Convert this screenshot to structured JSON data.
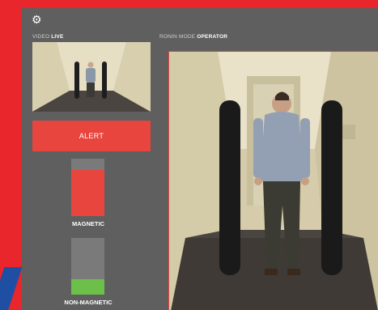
{
  "toolbar": {
    "settings_icon": "gear-icon"
  },
  "video": {
    "label": "VIDEO",
    "status": "LIVE"
  },
  "ronin": {
    "label": "RONIN MODE",
    "mode": "OPERATOR"
  },
  "alert": {
    "label": "ALERT"
  },
  "meters": {
    "magnetic": {
      "label": "MAGNETIC",
      "level": 0.8
    },
    "non_magnetic": {
      "label": "NON-MAGNETIC",
      "level": 0.27
    }
  },
  "colors": {
    "frame": "#e8262b",
    "panel": "#5f5f5f",
    "alert": "#e8453e",
    "ok": "#6cc04a"
  }
}
